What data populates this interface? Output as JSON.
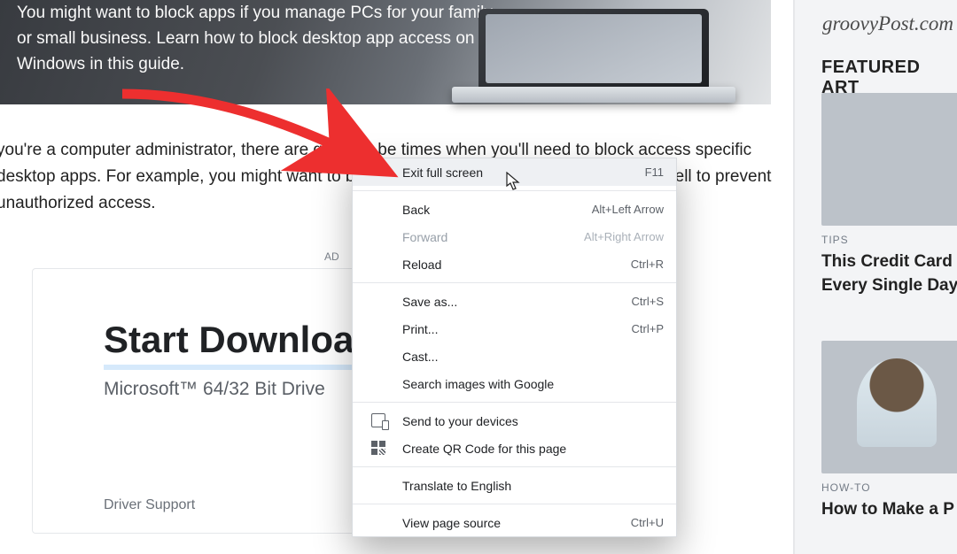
{
  "hero": {
    "text": "You might want to block apps if you manage PCs for your family or small business. Learn how to block desktop app access on Windows in this guide."
  },
  "article": {
    "paragraph": "you're a computer administrator, there are going to be times when you'll need to block access specific desktop apps. For example, you might want to block Command Prompt access like owerShell to prevent unauthorized access."
  },
  "sidebar": {
    "brand": "groovyPost.com",
    "featured_heading": "FEATURED ART",
    "cards": [
      {
        "category": "TIPS",
        "title": "This Credit Card Every Single Day"
      },
      {
        "category": "HOW-TO",
        "title": "How to Make a P"
      }
    ]
  },
  "ad": {
    "label": "AD",
    "headline": "Start Downloa",
    "subtitle": "Microsoft™ 64/32 Bit Drive",
    "source": "Driver Support"
  },
  "context_menu": {
    "items": [
      {
        "label": "Exit full screen",
        "shortcut": "F11",
        "enabled": true,
        "hover": true
      },
      {
        "divider": true
      },
      {
        "label": "Back",
        "shortcut": "Alt+Left Arrow",
        "enabled": true
      },
      {
        "label": "Forward",
        "shortcut": "Alt+Right Arrow",
        "enabled": false
      },
      {
        "label": "Reload",
        "shortcut": "Ctrl+R",
        "enabled": true
      },
      {
        "divider": true
      },
      {
        "label": "Save as...",
        "shortcut": "Ctrl+S",
        "enabled": true
      },
      {
        "label": "Print...",
        "shortcut": "Ctrl+P",
        "enabled": true
      },
      {
        "label": "Cast...",
        "shortcut": "",
        "enabled": true
      },
      {
        "label": "Search images with Google",
        "shortcut": "",
        "enabled": true
      },
      {
        "divider": true
      },
      {
        "label": "Send to your devices",
        "shortcut": "",
        "enabled": true,
        "icon": "devices"
      },
      {
        "label": "Create QR Code for this page",
        "shortcut": "",
        "enabled": true,
        "icon": "qr"
      },
      {
        "divider": true
      },
      {
        "label": "Translate to English",
        "shortcut": "",
        "enabled": true
      },
      {
        "divider": true
      },
      {
        "label": "View page source",
        "shortcut": "Ctrl+U",
        "enabled": true
      }
    ]
  }
}
